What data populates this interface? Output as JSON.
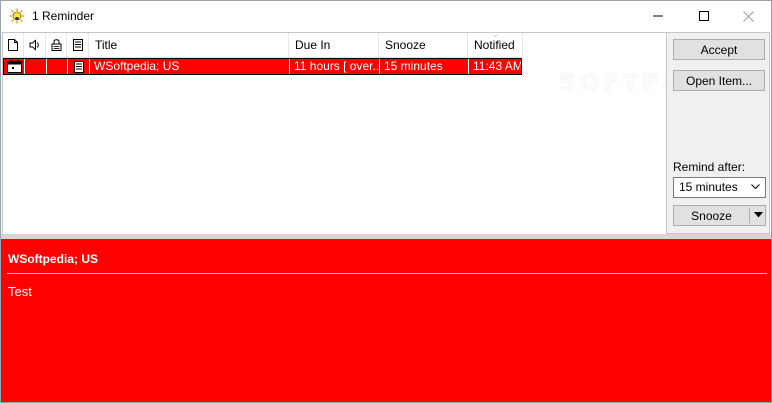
{
  "window": {
    "title": "1 Reminder",
    "icon": "reminder-bell-sun-icon"
  },
  "list": {
    "columns": [
      {
        "name": "type-icon",
        "label": ""
      },
      {
        "name": "sound-icon",
        "label": ""
      },
      {
        "name": "lock-icon",
        "label": ""
      },
      {
        "name": "note-icon",
        "label": ""
      },
      {
        "name": "title",
        "label": "Title"
      },
      {
        "name": "due-in",
        "label": "Due In"
      },
      {
        "name": "snooze",
        "label": "Snooze"
      },
      {
        "name": "notified",
        "label": "Notified"
      }
    ],
    "rows": [
      {
        "title": "WSoftpedia; US",
        "due_in": "11 hours [ over...",
        "snooze": "15 minutes",
        "notified": "11:43 AM"
      }
    ],
    "row_color": "#ff0000"
  },
  "panel": {
    "accept_label": "Accept",
    "open_label": "Open Item...",
    "remind_after_label": "Remind after:",
    "remind_after_value": "15 minutes",
    "snooze_label": "Snooze"
  },
  "watermark": "SOFTPEDIA",
  "detail": {
    "subject": "WSoftpedia; US",
    "body": "Test",
    "background": "#ff0000"
  }
}
